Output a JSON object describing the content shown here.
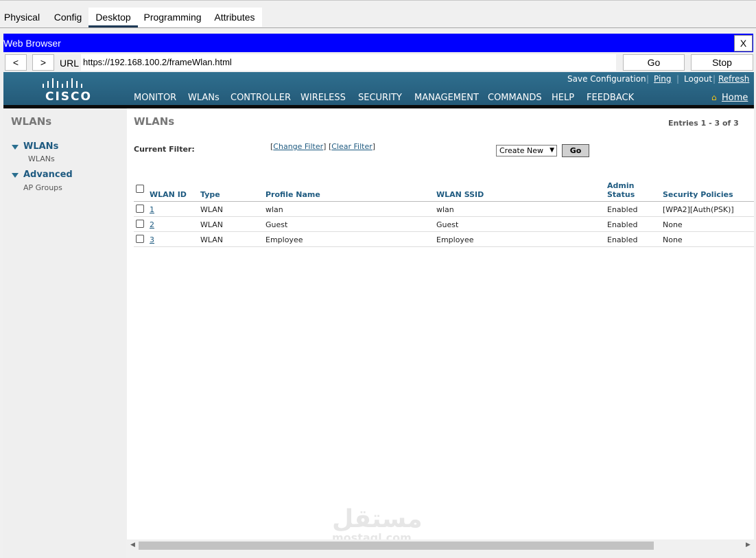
{
  "pt_tabs": [
    "Physical",
    "Config",
    "Desktop",
    "Programming",
    "Attributes"
  ],
  "browser": {
    "title": "Web Browser",
    "close": "X",
    "back": "<",
    "forward": ">",
    "url_label": "URL",
    "url": "https://192.168.100.2/frameWlan.html",
    "go": "Go",
    "stop": "Stop"
  },
  "header": {
    "logo": "CISCO",
    "top_links": [
      "Save Configuration",
      "Ping",
      "Logout",
      "Refresh"
    ],
    "nav": [
      "MONITOR",
      "WLANs",
      "CONTROLLER",
      "WIRELESS",
      "SECURITY",
      "MANAGEMENT",
      "COMMANDS",
      "HELP",
      "FEEDBACK"
    ],
    "home": "Home"
  },
  "sidebar": {
    "title": "WLANs",
    "groups": [
      {
        "label": "WLANs",
        "items": [
          "WLANs"
        ]
      },
      {
        "label": "Advanced",
        "items": [
          "AP Groups"
        ]
      }
    ]
  },
  "main": {
    "title": "WLANs",
    "entries": "Entries 1 - 3 of 3",
    "filter_label": "Current Filter:",
    "change_filter": "Change Filter",
    "clear_filter": "Clear Filter",
    "action_select": "Create New",
    "go": "Go",
    "columns": [
      "WLAN ID",
      "Type",
      "Profile Name",
      "WLAN SSID",
      "Admin",
      "Status",
      "Security Policies"
    ],
    "rows": [
      {
        "id": "1",
        "type": "WLAN",
        "profile": "wlan",
        "ssid": "wlan",
        "status": "Enabled",
        "security": "[WPA2][Auth(PSK)]"
      },
      {
        "id": "2",
        "type": "WLAN",
        "profile": "Guest",
        "ssid": "Guest",
        "status": "Enabled",
        "security": "None"
      },
      {
        "id": "3",
        "type": "WLAN",
        "profile": "Employee",
        "ssid": "Employee",
        "status": "Enabled",
        "security": "None"
      }
    ]
  },
  "watermark": {
    "arabic": "مستقل",
    "latin": "mostaql.com"
  }
}
